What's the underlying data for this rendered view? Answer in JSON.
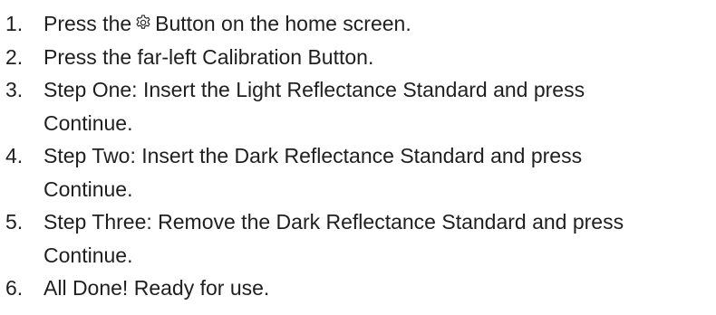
{
  "steps": [
    {
      "number": "1.",
      "before_icon": "Press the",
      "icon": "gear-icon",
      "after_icon": "Button on the home screen."
    },
    {
      "number": "2.",
      "text": "Press the far-left Calibration Button."
    },
    {
      "number": "3.",
      "line1": "Step One: Insert the Light Reflectance Standard and press",
      "line2": "Continue."
    },
    {
      "number": "4.",
      "line1": "Step Two: Insert the Dark Reflectance Standard and press",
      "line2": "Continue."
    },
    {
      "number": "5.",
      "line1": "Step Three: Remove the Dark Reflectance Standard and press",
      "line2": "Continue."
    },
    {
      "number": "6.",
      "text": "All Done! Ready for use."
    }
  ]
}
